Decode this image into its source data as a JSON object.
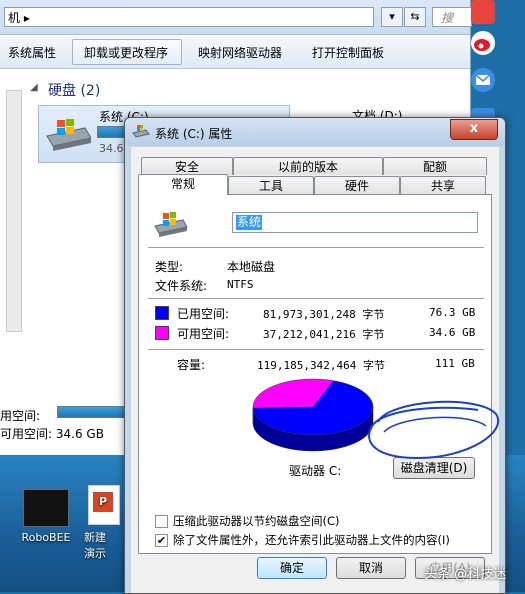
{
  "explorer": {
    "address_text": "机 ▸",
    "refresh_glyph": "⇆",
    "search_placeholder": "搜",
    "commands": [
      "系统属性",
      "卸载或更改程序",
      "映射网络驱动器",
      "打开控制面板"
    ],
    "group_title": "硬盘 (2)",
    "drive_c_name": "系统 (C:)",
    "drive_c_size": "34.6",
    "drive_d_name": "文档 (D:)",
    "used_label": "用空间:",
    "free_label": "可用空间: 34.6 GB"
  },
  "desktop": {
    "icon1_label": "RoboBEE",
    "icon2_label_line1": "新建",
    "icon2_label_line2": "演示"
  },
  "dialog": {
    "title": "系统 (C:) 属性",
    "close_glyph": "x",
    "tabs_row1": [
      "安全",
      "以前的版本",
      "配额"
    ],
    "tabs_row2": [
      "常规",
      "工具",
      "硬件",
      "共享"
    ],
    "volume_name": "系统",
    "type_label": "类型:",
    "type_value": "本地磁盘",
    "fs_label": "文件系统:",
    "fs_value": "NTFS",
    "used_label": "已用空间:",
    "used_bytes": "81,973,301,248 字节",
    "used_gb": "76.3 GB",
    "free_label": "可用空间:",
    "free_bytes": "37,212,041,216 字节",
    "free_gb": "34.6 GB",
    "capacity_label": "容量:",
    "capacity_bytes": "119,185,342,464 字节",
    "capacity_gb": "111 GB",
    "drive_label": "驱动器 C:",
    "cleanup_button": "磁盘清理(D)",
    "compress_label": "压缩此驱动器以节约磁盘空间(C)",
    "compress_checked": false,
    "index_label": "除了文件属性外，还允许索引此驱动器上文件的内容(I)",
    "index_checked": true,
    "check_glyph": "✔",
    "ok_button": "确定",
    "cancel_button": "取消",
    "apply_button": "应用(A)",
    "used_fraction": 0.688,
    "colors": {
      "used": "#0000ff",
      "free": "#ff00ff",
      "annotation": "#1a3fcf"
    }
  },
  "watermark": "头条 @科技迷"
}
